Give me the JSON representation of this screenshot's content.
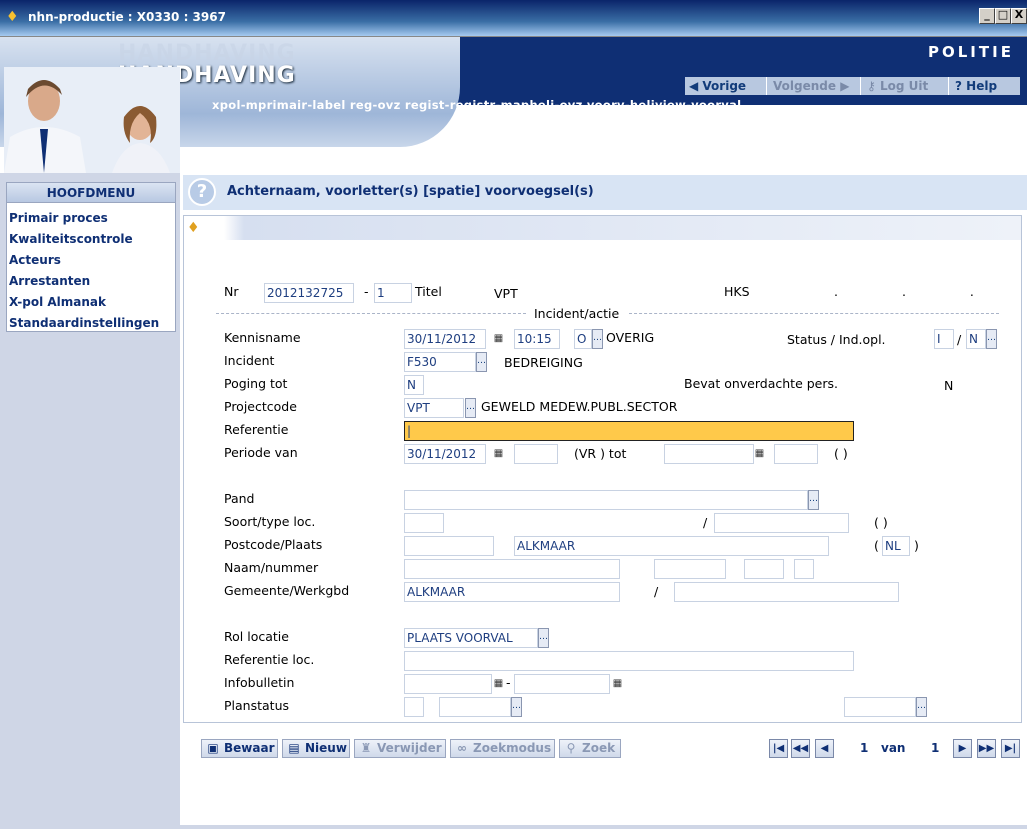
{
  "window": {
    "title": "nhn-productie : X0330 : 3967",
    "min": "_",
    "max": "□",
    "close": "X"
  },
  "header": {
    "app_title": "HANDHAVING",
    "logo_text": "POLITIE",
    "nav": {
      "prev": "Vorige",
      "next": "Volgende",
      "logout": "Log Uit",
      "help": "Help"
    },
    "xpath": "xpol-mprimair-label reg-ovz regist-registr-mapheli-ovz voorv-heliview-voorval"
  },
  "sidebar": {
    "title": "HOOFDMENU",
    "items": [
      "Primair proces",
      "Kwaliteitscontrole",
      "Acteurs",
      "Arrestanten",
      "X-pol Almanak",
      "Standaardinstellingen"
    ]
  },
  "question": {
    "text": "Achternaam, voorletter(s) [spatie] voorvoegsel(s)"
  },
  "form": {
    "nr_label": "Nr",
    "nr_value": "2012132725",
    "dash": "-",
    "nr_suffix": "1",
    "titel_label": "Titel",
    "titel_value": "VPT",
    "hks_label": "HKS",
    "dots": ". . .",
    "section_incident": "Incident/actie",
    "kennisname_label": "Kennisname",
    "kennisname_date": "30/11/2012",
    "kennisname_time": "10:15",
    "kennisname_code": "O",
    "kennisname_desc": "OVERIG",
    "status_label": "Status / Ind.opl.",
    "status_value": "I",
    "slash": "/",
    "indopl_value": "N",
    "incident_label": "Incident",
    "incident_code": "F530",
    "incident_desc": "BEDREIGING",
    "poging_label": "Poging tot",
    "poging_value": "N",
    "verdachte_label": "Bevat onverdachte pers.",
    "verdachte_value": "N",
    "project_label": "Projectcode",
    "project_code": "VPT",
    "project_desc": "GEWELD MEDEW.PUBL.SECTOR",
    "referentie_label": "Referentie",
    "referentie_value": "|",
    "periode_label": "Periode van",
    "periode_date": "30/11/2012",
    "periode_vr": "(VR ) tot",
    "periode_paren": "(    )",
    "pand_label": "Pand",
    "soort_label": "Soort/type loc.",
    "soort_paren": "(    )",
    "postcode_label": "Postcode/Plaats",
    "plaats_value": "ALKMAAR",
    "land_open": "(",
    "land_value": "NL",
    "land_close": ")",
    "naam_label": "Naam/nummer",
    "gemeente_label": "Gemeente/Werkgbd",
    "gemeente_value": "ALKMAAR",
    "rol_label": "Rol locatie",
    "rol_value": "PLAATS VOORVAL",
    "refloc_label": "Referentie loc.",
    "info_label": "Infobulletin",
    "plan_label": "Planstatus"
  },
  "toolbar": {
    "save": "Bewaar",
    "new": "Nieuw",
    "delete": "Verwijder",
    "search_mode": "Zoekmodus",
    "search": "Zoek",
    "page_current": "1",
    "page_of": "van",
    "page_total": "1"
  },
  "colors": {
    "brand": "#0f2f74",
    "active_field": "#ffc94a"
  }
}
